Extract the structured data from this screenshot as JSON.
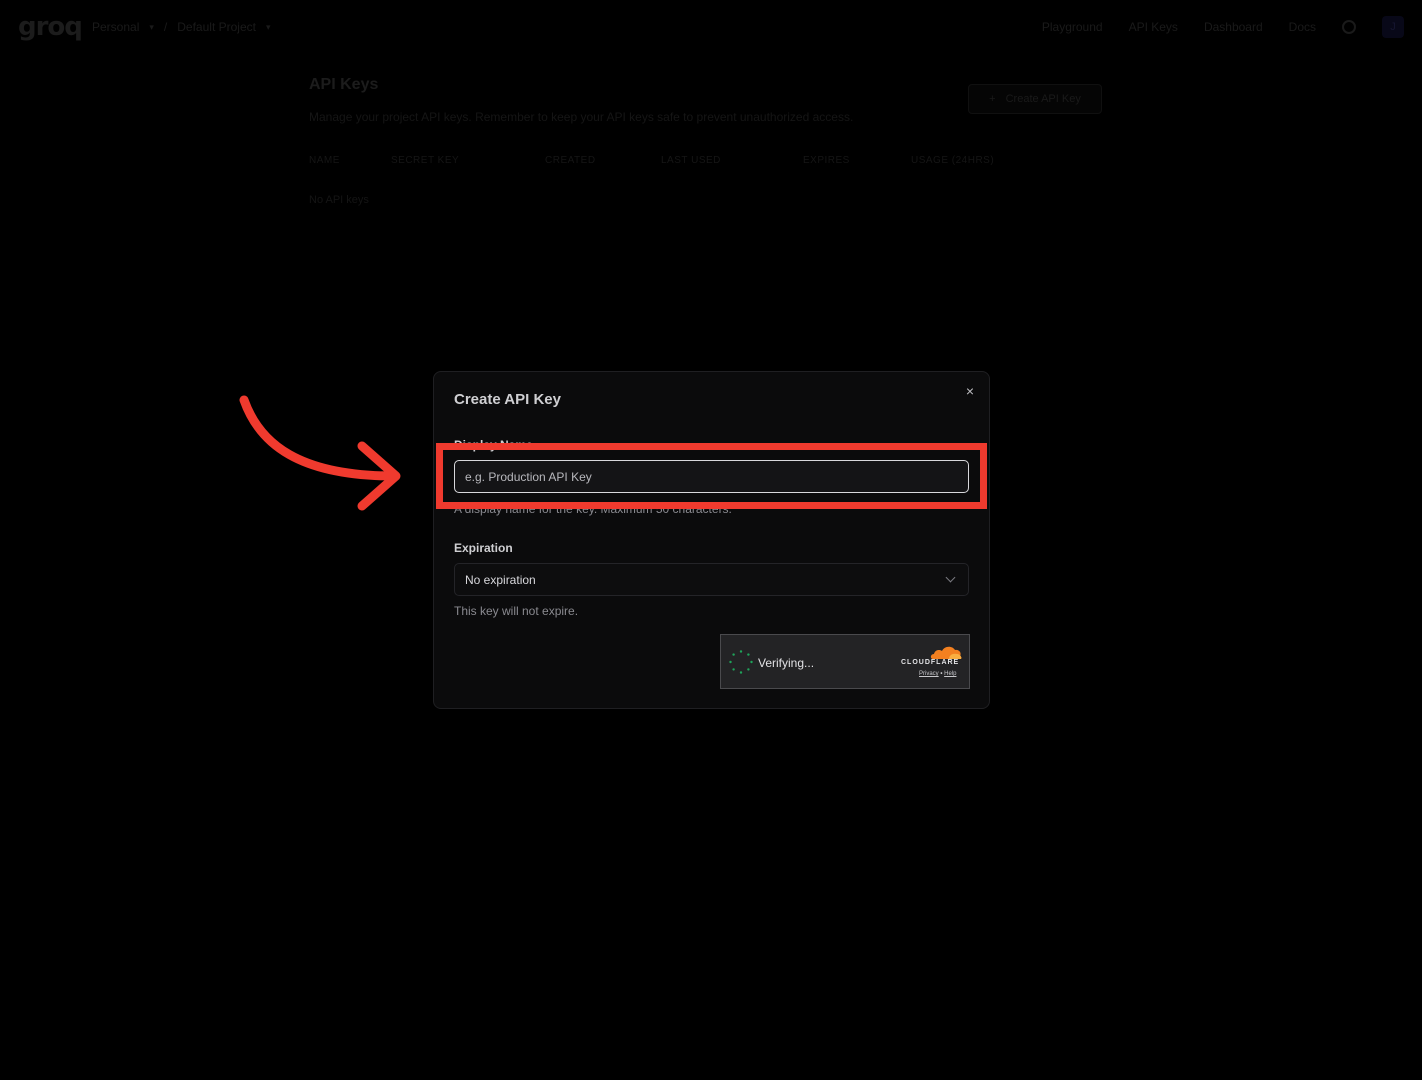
{
  "app": {
    "logo": "groq",
    "breadcrumb": {
      "org": "Personal",
      "separator": "/",
      "project": "Default Project"
    },
    "nav": [
      "Playground",
      "API Keys",
      "Dashboard",
      "Docs"
    ],
    "avatar_initial": "J"
  },
  "page": {
    "title": "API Keys",
    "description": "Manage your project API keys. Remember to keep your API keys safe to prevent unauthorized access.",
    "create_button": "Create API Key",
    "create_button_icon": "plus-icon",
    "table": {
      "columns": [
        "NAME",
        "SECRET KEY",
        "CREATED",
        "LAST USED",
        "EXPIRES",
        "USAGE (24HRS)"
      ],
      "empty_text": "No API keys"
    }
  },
  "modal": {
    "title": "Create API Key",
    "close_label": "×",
    "display_name": {
      "label": "Display Name",
      "placeholder": "e.g. Production API Key",
      "hint": "A display name for the key. Maximum 50 characters."
    },
    "expiration": {
      "label": "Expiration",
      "value": "No expiration",
      "hint": "This key will not expire."
    },
    "captcha": {
      "status": "Verifying...",
      "brand": "CLOUDFLARE",
      "privacy": "Privacy",
      "link_sep": "•",
      "help": "Help"
    }
  },
  "annotation": {
    "color": "#f03a2e",
    "target": "display-name-input"
  }
}
